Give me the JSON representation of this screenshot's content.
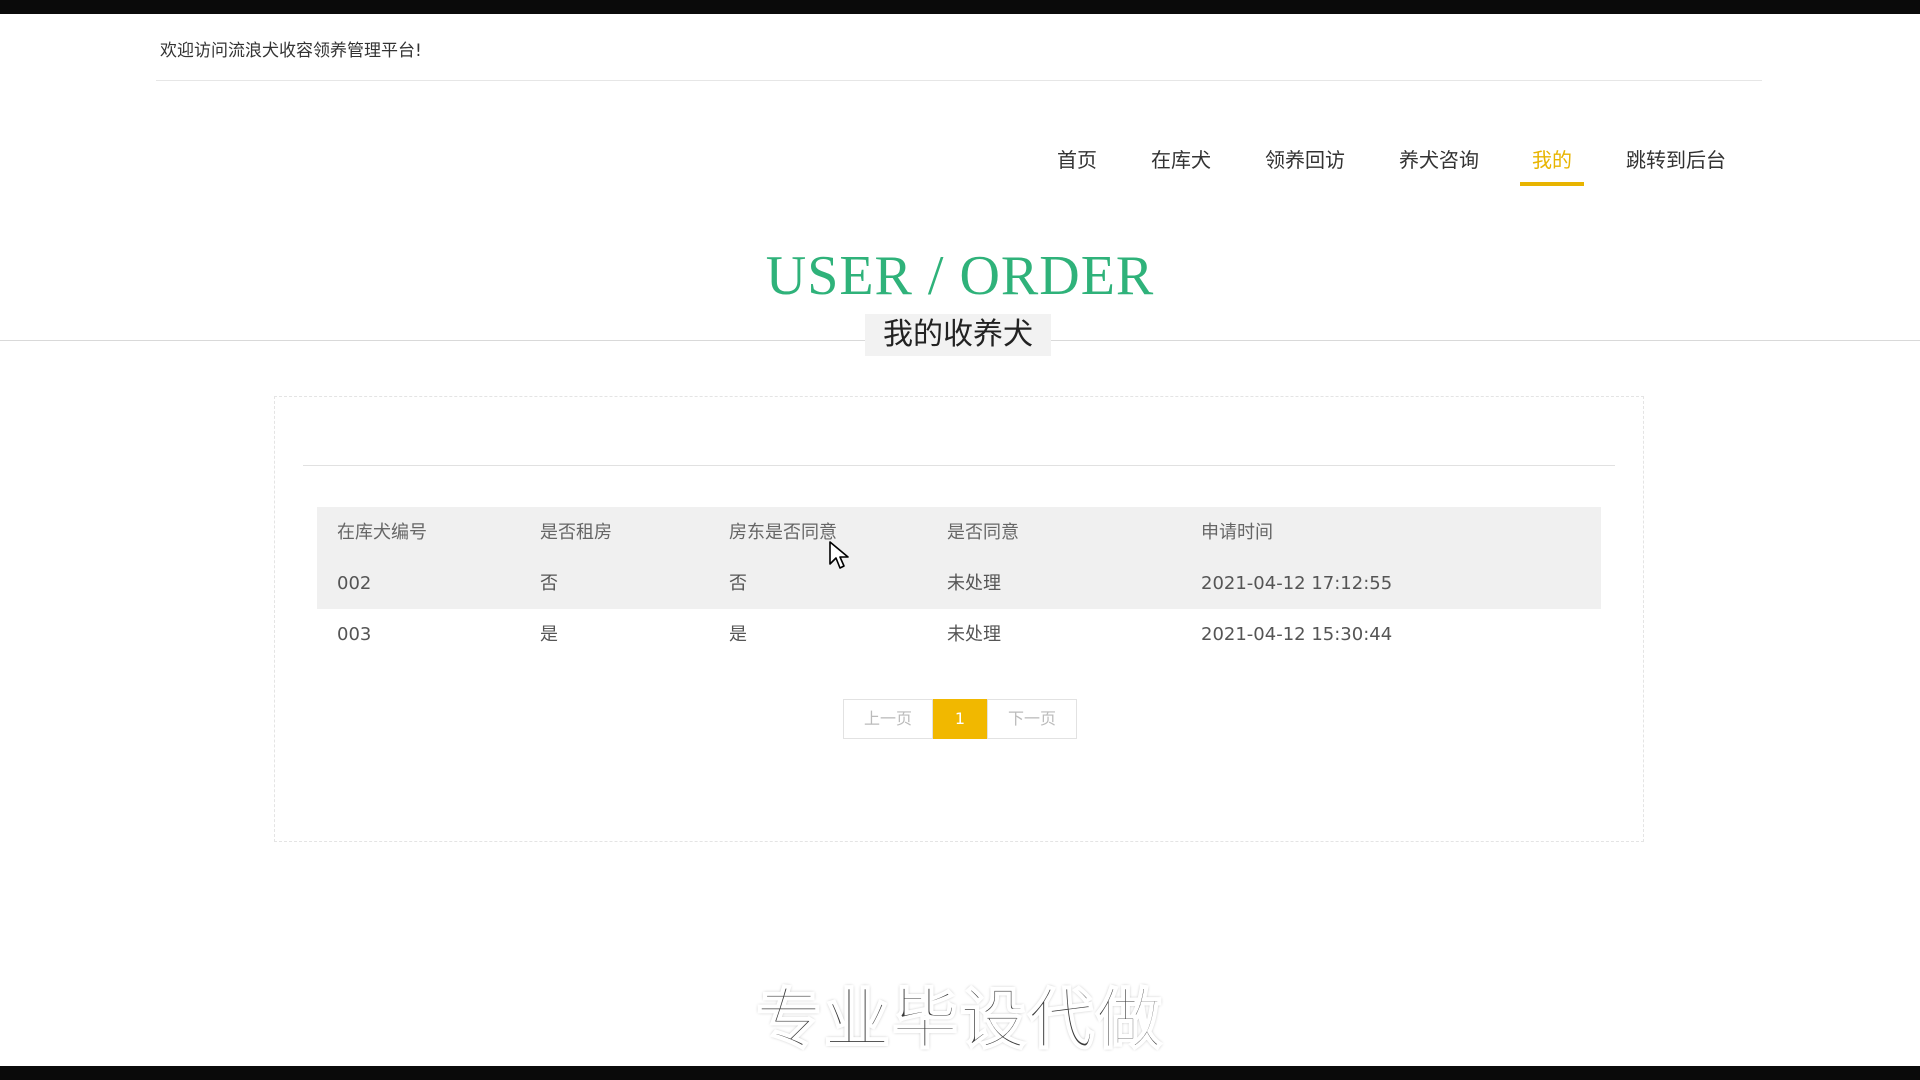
{
  "header": {
    "welcome": "欢迎访问流浪犬收容领养管理平台!"
  },
  "nav": {
    "items": [
      {
        "label": "首页",
        "active": false
      },
      {
        "label": "在库犬",
        "active": false
      },
      {
        "label": "领养回访",
        "active": false
      },
      {
        "label": "养犬咨询",
        "active": false
      },
      {
        "label": "我的",
        "active": true
      },
      {
        "label": "跳转到后台",
        "active": false
      }
    ]
  },
  "hero": {
    "title": "USER / ORDER",
    "subtitle": "我的收养犬"
  },
  "table": {
    "columns": [
      "在库犬编号",
      "是否租房",
      "房东是否同意",
      "是否同意",
      "申请时间"
    ],
    "rows": [
      [
        "002",
        "否",
        "否",
        "未处理",
        "2021-04-12 17:12:55"
      ],
      [
        "003",
        "是",
        "是",
        "未处理",
        "2021-04-12 15:30:44"
      ]
    ]
  },
  "pagination": {
    "prev": "上一页",
    "current": "1",
    "next": "下一页"
  },
  "overlay": {
    "watermark": "专业毕设代做"
  },
  "colors": {
    "accent": "#e8b400",
    "title_green": "#2fb27a",
    "page_active": "#f1b800"
  }
}
